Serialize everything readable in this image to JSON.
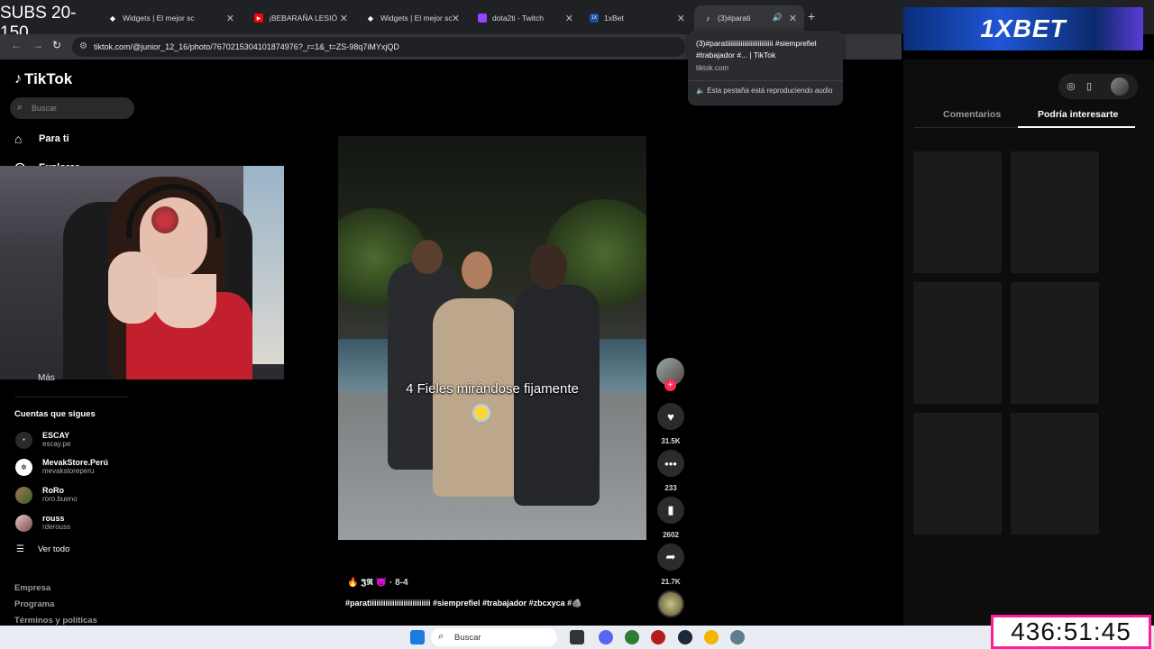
{
  "overlay": {
    "subs_counter": "SUBS 20- 150",
    "timer": "436:51:45",
    "ad_brand": "1XBET"
  },
  "browser": {
    "tabs": [
      {
        "label": "Widgets | El mejor sc"
      },
      {
        "label": "¡BEBARAÑA LESIÓ"
      },
      {
        "label": "Widgets | El mejor sc"
      },
      {
        "label": "dota2ti - Twitch"
      },
      {
        "label": "1xBet"
      },
      {
        "label": "(3)#parati"
      }
    ],
    "url": "tiktok.com/@junior_12_16/photo/7670215304101874976?_r=1&_t=ZS-98q7iMYxjQD",
    "tooltip": {
      "title": "(3)#paratiiiiiiiiiiiiiiiiiiiiiiiiiii #siempreﬁel #trabajador #... | TikTok",
      "domain": "tiktok.com",
      "audio": "Esta pestaña está reproduciendo audio"
    }
  },
  "sidebar": {
    "brand": "TikTok",
    "search_placeholder": "Buscar",
    "nav": [
      {
        "label": "Para ti",
        "icon": "home-icon"
      },
      {
        "label": "Explorar",
        "icon": "compass-icon"
      }
    ],
    "more_label": "Más",
    "following_title": "Cuentas que sigues",
    "following": [
      {
        "name": "ESCAY",
        "handle": "escay.pe"
      },
      {
        "name": "MevakStore.Perú",
        "handle": "mevakstoreperu"
      },
      {
        "name": "RoRo",
        "handle": "roro.bueno"
      },
      {
        "name": "rouss",
        "handle": "rderouss"
      }
    ],
    "see_all": "Ver todo",
    "footer_links": [
      "Empresa",
      "Programa",
      "Términos y políticas"
    ]
  },
  "video": {
    "caption": "4 Fieles mirándose fijamente",
    "author": "🔥 𝕵𝕽 👿 · 8-4",
    "description": "#paratiiiiiiiiiiiiiiiiiiiiiiiiiii #siempreﬁel #trabajador #zbcxyca #🪨",
    "likes": "31.5K",
    "comments": "233",
    "saves": "2602",
    "shares": "21.7K"
  },
  "right_panel": {
    "tabs": [
      "Comentarios",
      "Podría interesarte"
    ],
    "active_tab": "Podría interesarte"
  },
  "taskbar": {
    "search_label": "Buscar"
  }
}
